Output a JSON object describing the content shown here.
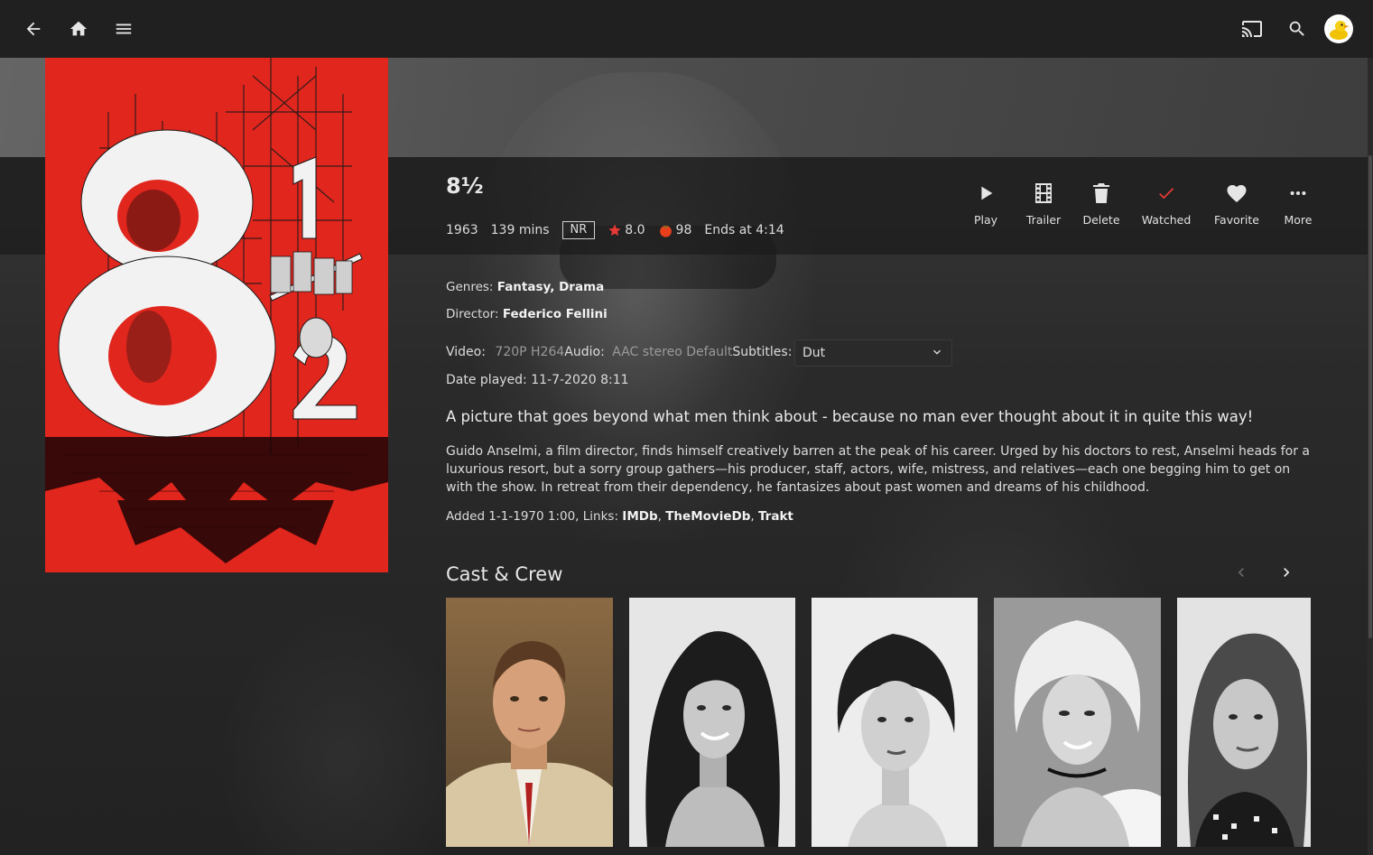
{
  "header": {
    "back_icon": "arrow-left-icon",
    "home_icon": "home-icon",
    "menu_icon": "hamburger-menu-icon",
    "cast_icon": "cast-icon",
    "search_icon": "search-icon",
    "avatar_icon": "duck-avatar-icon"
  },
  "item": {
    "title": "8½",
    "year": "1963",
    "runtime": "139 mins",
    "official_rating": "NR",
    "community_rating": "8.0",
    "critic_rating": "98",
    "ends_at": "Ends at 4:14"
  },
  "actions": [
    {
      "label": "Play",
      "icon": "play-icon"
    },
    {
      "label": "Trailer",
      "icon": "film-strip-icon"
    },
    {
      "label": "Delete",
      "icon": "trash-icon"
    },
    {
      "label": "Watched",
      "icon": "checkmark-icon",
      "color": "#e53935"
    },
    {
      "label": "Favorite",
      "icon": "heart-icon"
    },
    {
      "label": "More",
      "icon": "more-horizontal-icon"
    }
  ],
  "details": {
    "genres_label": "Genres:",
    "genres_value": "Fantasy, Drama",
    "director_label": "Director:",
    "director_value": "Federico Fellini",
    "video_label": "Video:",
    "video_value": "720P H264",
    "audio_label": "Audio:",
    "audio_value": "AAC stereo Default",
    "subtitles_label": "Subtitles:",
    "subtitles_value": "Dut",
    "date_played": "Date played: 11-7-2020 8:11"
  },
  "tagline": "A picture that goes beyond what men think about - because no man ever thought about it in quite this way!",
  "overview": "Guido Anselmi, a film director, finds himself creatively barren at the peak of his career. Urged by his doctors to rest, Anselmi heads for a luxurious resort, but a sorry group gathers—his producer, staff, actors, wife, mistress, and relatives—each one begging him to get on with the show. In retreat from their dependency, he fantasizes about past women and dreams of his childhood.",
  "added": {
    "prefix": "Added 1-1-1970 1:00, Links: ",
    "links": [
      "IMDb",
      "TheMovieDb",
      "Trakt"
    ]
  },
  "cast": {
    "heading": "Cast & Crew",
    "prev_icon": "chevron-left-icon",
    "next_icon": "chevron-right-icon"
  },
  "colors": {
    "accent_red": "#e53935",
    "poster_red": "#e0261d",
    "star": "#e53935",
    "tomato": "#e8401c"
  }
}
